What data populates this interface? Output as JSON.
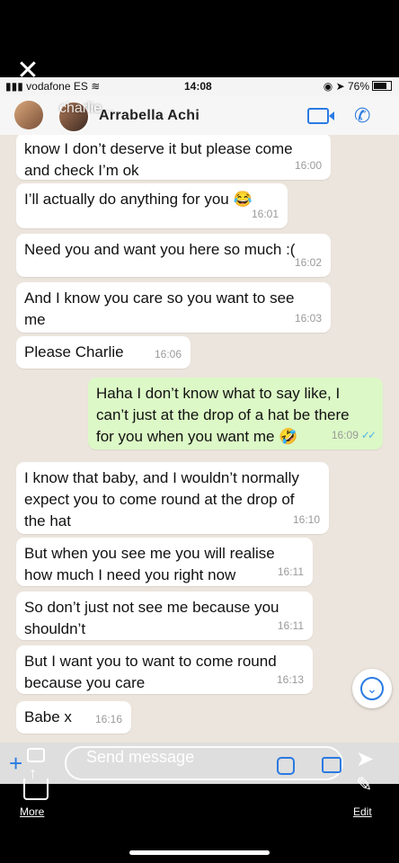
{
  "status_bar": {
    "carrier": "vodafone ES",
    "time": "14:08",
    "battery": "76%"
  },
  "story": {
    "close_glyph": "✕",
    "username_overlay": "charlie..."
  },
  "chat_header": {
    "contact_name": "Arrabella  Achi",
    "video_call_icon": "video-icon",
    "voice_call_icon": "phone-icon"
  },
  "messages": [
    {
      "dir": "in",
      "text": "know I don’t deserve it but please come\nand check I’m ok",
      "time": "16:00"
    },
    {
      "dir": "in",
      "text": "I’ll actually do anything for you 😂",
      "time": "16:01"
    },
    {
      "dir": "in",
      "text": "Need you and want you here so much :(",
      "time": "16:02"
    },
    {
      "dir": "in",
      "text": "And I know you care so you want to see\nme",
      "time": "16:03"
    },
    {
      "dir": "in",
      "text": "Please Charlie",
      "time": "16:06"
    },
    {
      "dir": "out",
      "text": "Haha I don’t know what to say like, I\ncan’t just at the drop of a hat be there\nfor you when you want me 🤣",
      "time": "16:09"
    },
    {
      "dir": "in",
      "text": "I know that baby, and I wouldn’t normally\nexpect you to come round at the drop of\nthe hat",
      "time": "16:10"
    },
    {
      "dir": "in",
      "text": "But when you see me you will realise\nhow much I need you right now",
      "time": "16:11"
    },
    {
      "dir": "in",
      "text": "So don’t just not see me because you\nshouldn’t",
      "time": "16:11"
    },
    {
      "dir": "in",
      "text": "But I want you to want to come round\nbecause you care",
      "time": "16:13"
    },
    {
      "dir": "in",
      "text": "Babe x",
      "time": "16:16"
    }
  ],
  "input": {
    "placeholder": "Send message"
  },
  "bottom": {
    "more_label": "More",
    "edit_label": "Edit"
  },
  "colors": {
    "incoming_bubble": "#ffffff",
    "outgoing_bubble": "#dcf8c6",
    "accent": "#2a7ae2",
    "read_check": "#4fb5ec",
    "chat_bg": "#ece5dd"
  }
}
